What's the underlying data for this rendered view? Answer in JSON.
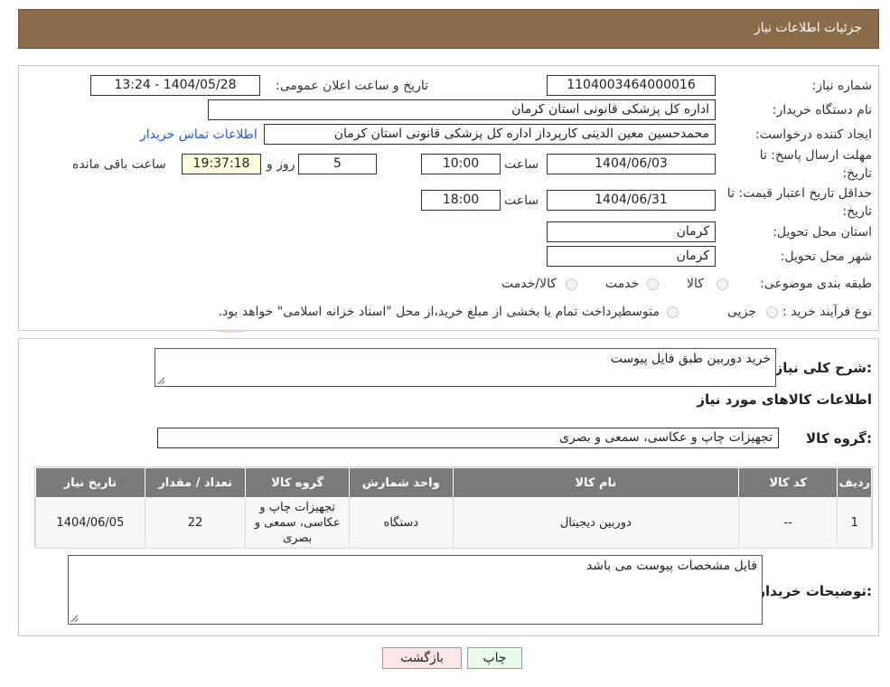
{
  "header": {
    "title": "جزئيات اطلاعات نياز"
  },
  "form": {
    "need_number_label": "شماره نیاز:",
    "need_number": "1104003464000016",
    "announce_label": "تاریخ و ساعت اعلان عمومی:",
    "announce_value": "1404/05/28 - 13:24",
    "buyer_org_label": "نام دستگاه خریدار:",
    "buyer_org": "اداره کل پزشکی قانونی استان کرمان",
    "creator_label": "ایجاد کننده درخواست:",
    "creator": "محمدحسین معین الدینی کارپرداز اداره کل پزشکی قانونی استان کرمان",
    "contact_link": "اطلاعات تماس خریدار",
    "deadline_label_1": "مهلت ارسال پاسخ: تا",
    "deadline_label_2": "تاریخ:",
    "deadline_date": "1404/06/03",
    "hour_label": "ساعت",
    "deadline_time": "10:00",
    "days_value": "5",
    "days_label": "روز و",
    "remaining_time": "19:37:18",
    "remaining_label": "ساعت باقی مانده",
    "validity_label_1": "حداقل تاریخ اعتبار قیمت: تا",
    "validity_label_2": "تاریخ:",
    "validity_date": "1404/06/31",
    "validity_hour_label": "ساعت",
    "validity_time": "18:00",
    "province_label": "استان محل تحویل:",
    "province": "کرمان",
    "city_label": "شهر محل تحویل:",
    "city": "کرمان",
    "category_label": "طبقه بندی موضوعی:",
    "category_options": [
      "کالا",
      "خدمت",
      "کالا/خدمت"
    ],
    "purchase_type_label": "نوع فرآیند خرید :",
    "purchase_options": [
      "جزیی",
      "متوسط"
    ],
    "purchase_note": "پرداخت تمام یا بخشی از مبلغ خرید،از محل \"اسناد خزانه اسلامی\" خواهد بود."
  },
  "details": {
    "summary_label": "شرح کلی نیاز:",
    "summary": "خرید دوربین طبق فایل پیوست",
    "goods_info_title": "اطلاعات کالاهای مورد نیاز",
    "goods_group_label": "گروه کالا:",
    "goods_group": "تجهیزات چاپ و عکاسی، سمعی و بصری",
    "table": {
      "headers": [
        "ردیف",
        "کد کالا",
        "نام کالا",
        "واحد شمارش",
        "گروه کالا",
        "تعداد / مقدار",
        "تاریخ نیاز"
      ],
      "rows": [
        [
          "1",
          "--",
          "دوربین دیجیتال",
          "دستگاه",
          "تجهیزات چاپ و عکاسی، سمعی و بصری",
          "22",
          "1404/06/05"
        ]
      ]
    },
    "buyer_notes_label": "توضیحات خریدار:",
    "buyer_notes": "فایل مشخصات پیوست می باشد"
  },
  "buttons": {
    "print": "چاپ",
    "back": "بازگشت"
  },
  "watermark": {
    "text": "AriaTender.neT"
  },
  "colors": {
    "header": "#8a6d48",
    "table_header": "#7a7a7a",
    "link": "#1e5bd6"
  }
}
